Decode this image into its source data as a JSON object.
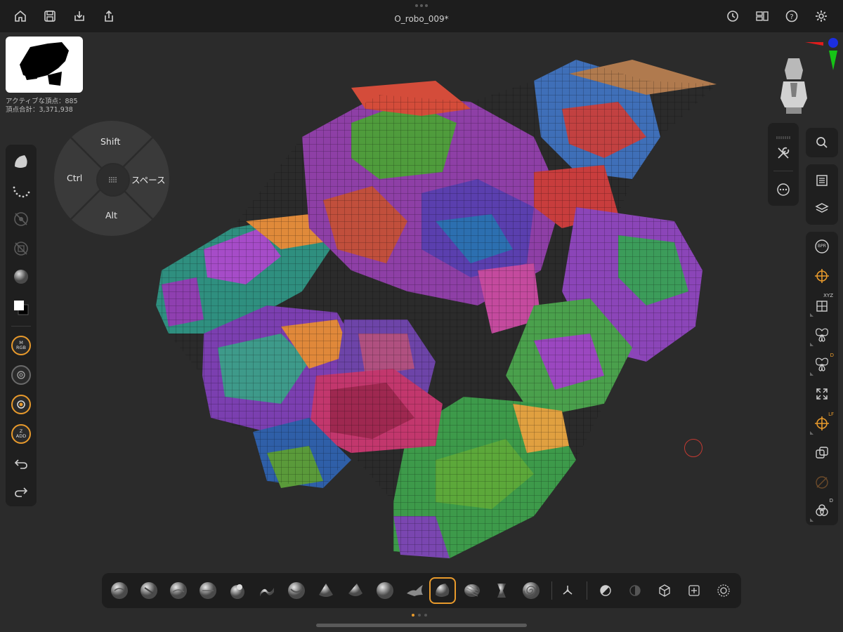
{
  "document": {
    "title": "O_robo_009*"
  },
  "top_left_tools": [
    {
      "name": "home-button",
      "icon": "home-icon"
    },
    {
      "name": "save-button",
      "icon": "save-icon"
    },
    {
      "name": "import-button",
      "icon": "import-icon"
    },
    {
      "name": "share-button",
      "icon": "share-icon"
    }
  ],
  "top_right_tools": [
    {
      "name": "history-button",
      "icon": "history-icon"
    },
    {
      "name": "layout-button",
      "icon": "layout-icon"
    },
    {
      "name": "help-button",
      "icon": "help-icon"
    },
    {
      "name": "settings-button",
      "icon": "gear-icon"
    }
  ],
  "stats": {
    "active_vertices": "アクティブな頂点：885",
    "total_vertices": "頂点合計：3,371,938"
  },
  "modifier_pad": {
    "top": "Shift",
    "left": "Ctrl",
    "right": "スペース",
    "bottom": "Alt"
  },
  "left_toolbar": {
    "rgb_ring": {
      "top": "M",
      "bottom": "RGB"
    },
    "z_ring": {
      "top": "Z",
      "bottom": "ADD"
    }
  },
  "right_toolbar": {
    "bpr_label": "BPR",
    "xyz_tag": "XYZ",
    "d_tag": "D",
    "lf_tag": "LF",
    "d2_tag": "D"
  },
  "bottom_brushes": [
    "clay-buildup-brush",
    "dam-standard-brush",
    "standard-brush",
    "move-brush",
    "inflate-brush",
    "snakehook-brush",
    "pinch-brush",
    "trim-dynamic-brush",
    "hpolish-brush",
    "smooth-brush",
    "stroke-brush",
    "selected-brush",
    "curve-brush",
    "knife-brush",
    "spiral-brush"
  ],
  "colors": {
    "accent": "#e89a2c",
    "background": "#2b2b2b",
    "bar": "#1d1d1d"
  }
}
